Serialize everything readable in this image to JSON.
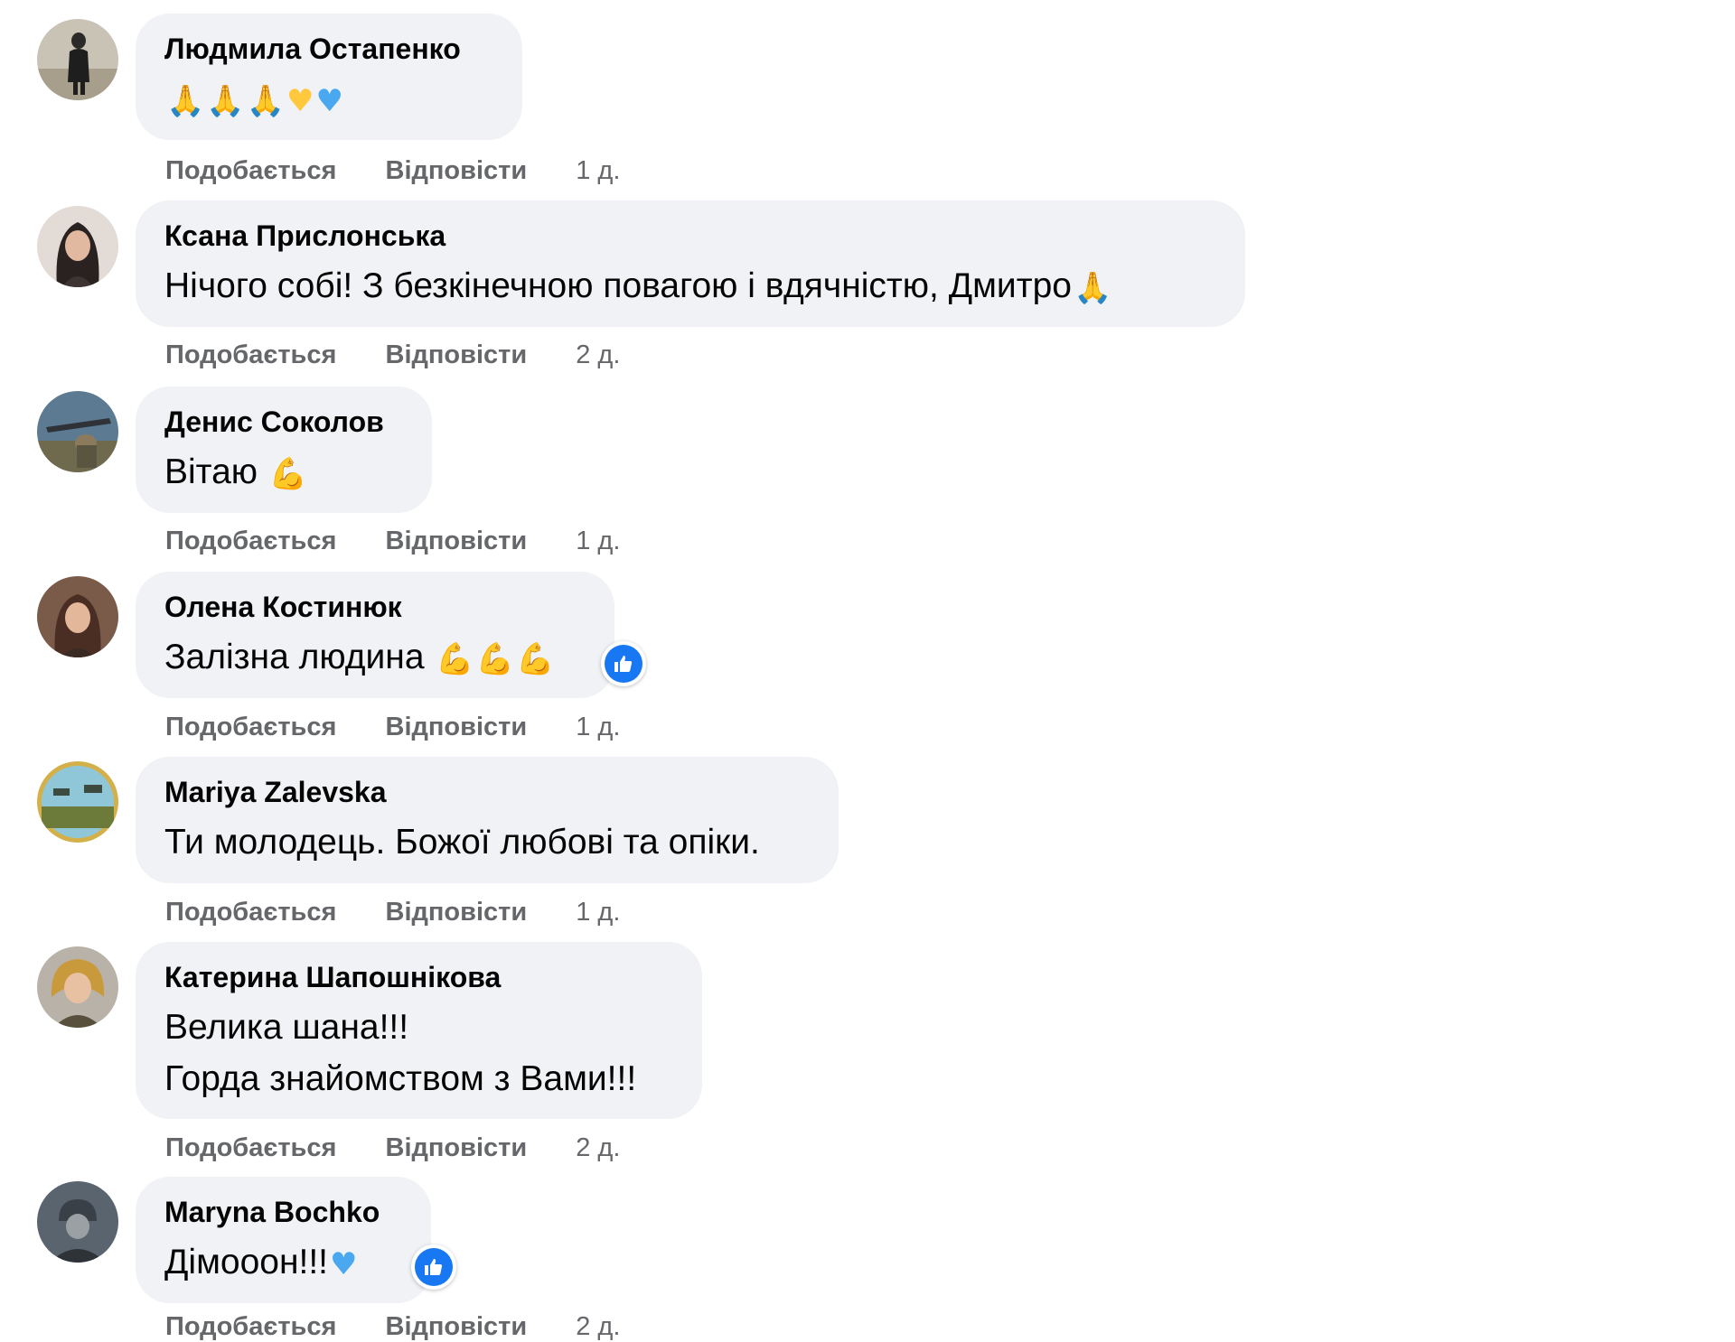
{
  "colors": {
    "bubble_bg": "#f0f2f5",
    "action_text": "#65676b",
    "like_reaction": "#1877f2"
  },
  "actions": {
    "like": "Подобається",
    "reply": "Відповісти"
  },
  "comments": [
    {
      "author": "Людмила Остапенко",
      "lines": [
        ""
      ],
      "emojis": [
        "pray",
        "pray",
        "pray",
        "yellow-heart",
        "blue-heart"
      ],
      "time": "1 д."
    },
    {
      "author": "Ксана Прислонська",
      "lines": [
        "Нічого собі! З безкінечною повагою і вдячністю, Дмитро"
      ],
      "emojis": [
        "pray"
      ],
      "time": "2 д."
    },
    {
      "author": "Денис Соколов",
      "lines": [
        "Вітаю"
      ],
      "emojis": [
        "flexed-biceps"
      ],
      "time": "1 д."
    },
    {
      "author": "Олена Костинюк",
      "lines": [
        "Залізна людина"
      ],
      "emojis": [
        "flexed-biceps",
        "flexed-biceps",
        "flexed-biceps"
      ],
      "reaction": "like-icon",
      "time": "1 д."
    },
    {
      "author": "Mariya Zalevska",
      "lines": [
        "Ти молодець. Божої любові та опіки."
      ],
      "time": "1 д."
    },
    {
      "author": "Катерина Шапошнікова",
      "lines": [
        "Велика шана!!!",
        "Горда знайомством з Вами!!!"
      ],
      "time": "2 д."
    },
    {
      "author": "Maryna Bochko",
      "lines": [
        "Дімооон!!!"
      ],
      "emojis": [
        "blue-heart"
      ],
      "reaction": "like-icon",
      "time": "2 д."
    }
  ]
}
